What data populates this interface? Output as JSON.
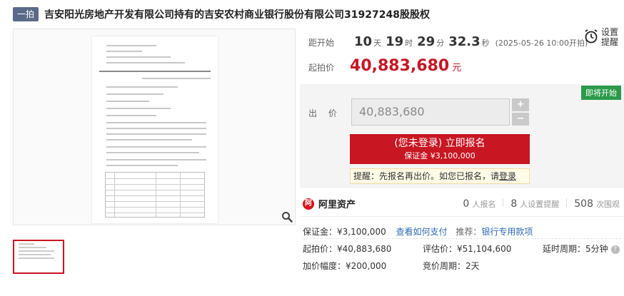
{
  "title": {
    "round": "一拍",
    "text": "吉安阳光房地产开发有限公司持有的吉安农村商业银行股份有限公司31927248股股权"
  },
  "countdown": {
    "label": "距开始",
    "days": "10",
    "days_unit": "天",
    "hours": "19",
    "hours_unit": "时",
    "minutes": "29",
    "minutes_unit": "分",
    "seconds": "32.3",
    "seconds_unit": "秒",
    "note": "(2025-05-26 10:00开拍)"
  },
  "start_price": {
    "label": "起拍价",
    "value": "40,883,680",
    "unit": "元"
  },
  "remind": {
    "line1": "设置",
    "line2": "提醒",
    "icon": "alarm-clock-icon"
  },
  "bid": {
    "status": "即将开始",
    "label": "出 价",
    "value": "40,883,680",
    "plus": "+",
    "minus": "−",
    "signup_main": "(您未登录) 立即报名",
    "signup_sub": "保证金 ¥3,100,000",
    "notice_text": "提醒：先报名再出价。如您已报名，请",
    "notice_link": "登录"
  },
  "platform": {
    "name": "阿里资产",
    "signups": "0",
    "signups_label": "人报名",
    "reminders": "8",
    "reminders_label": "人设置提醒",
    "views": "508",
    "views_label": "次围观"
  },
  "details": {
    "deposit": "保证金：¥3,100,000",
    "pay_link": "查看如何支付",
    "recommend_label": "推荐：",
    "recommend_link": "银行专用款项",
    "start_price": "起拍价：¥40,883,680",
    "appraisal": "评估价：¥51,104,600",
    "delay": "延时周期：5分钟",
    "increment": "加价幅度：¥200,000",
    "bid_period": "竞价周期：2天"
  },
  "colors": {
    "accent": "#c81623",
    "status_green": "#2a9a4a",
    "link_blue": "#2d6bb3"
  }
}
